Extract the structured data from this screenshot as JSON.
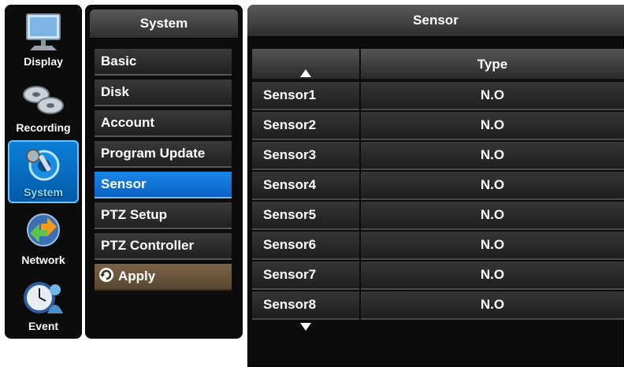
{
  "nav": [
    {
      "label": "Display",
      "icon": "monitor-icon",
      "active": false
    },
    {
      "label": "Recording",
      "icon": "reels-icon",
      "active": false
    },
    {
      "label": "System",
      "icon": "gear-icon",
      "active": true
    },
    {
      "label": "Network",
      "icon": "network-icon",
      "active": false
    },
    {
      "label": "Event",
      "icon": "clock-person-icon",
      "active": false
    }
  ],
  "menu": {
    "title": "System",
    "items": [
      "Basic",
      "Disk",
      "Account",
      "Program Update",
      "Sensor",
      "PTZ Setup",
      "PTZ Controller"
    ],
    "active": "Sensor",
    "apply_label": "Apply"
  },
  "sensor": {
    "title": "Sensor",
    "column_header": "Type",
    "rows": [
      {
        "name": "Sensor1",
        "type": "N.O"
      },
      {
        "name": "Sensor2",
        "type": "N.O"
      },
      {
        "name": "Sensor3",
        "type": "N.O"
      },
      {
        "name": "Sensor4",
        "type": "N.O"
      },
      {
        "name": "Sensor5",
        "type": "N.O"
      },
      {
        "name": "Sensor6",
        "type": "N.O"
      },
      {
        "name": "Sensor7",
        "type": "N.O"
      },
      {
        "name": "Sensor8",
        "type": "N.O"
      }
    ]
  },
  "colors": {
    "accent": "#0a6fd0",
    "apply": "#6b5540",
    "panel": "#0c0c0c"
  }
}
